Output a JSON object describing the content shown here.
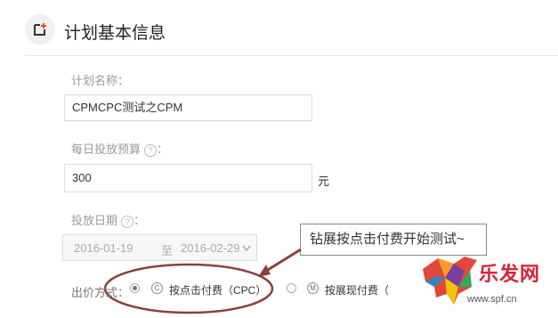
{
  "header": {
    "title": "计划基本信息",
    "icon": "add-box-icon"
  },
  "plan_name": {
    "label": "计划名称：",
    "value": "CPMCPC测试之CPM"
  },
  "daily_budget": {
    "label": "每日投放预算",
    "help": "?",
    "colon": "：",
    "value": "300",
    "unit": "元"
  },
  "date_range": {
    "label": "投放日期",
    "help": "?",
    "colon": "：",
    "start": "2016-01-19",
    "separator": "至",
    "end": "2016-02-29"
  },
  "bidding": {
    "label": "出价方式：",
    "options": [
      {
        "icon_text": "C",
        "label": "按点击付费（CPC）",
        "selected": true
      },
      {
        "icon_text": "M",
        "label": "按展现付费（",
        "selected": false
      }
    ]
  },
  "annotation": {
    "text": "钻展按点击付费开始测试~",
    "color": "#8b4040"
  },
  "watermark": {
    "brand": "乐发网",
    "url": "www.spf.cn",
    "color": "#d6243a"
  }
}
